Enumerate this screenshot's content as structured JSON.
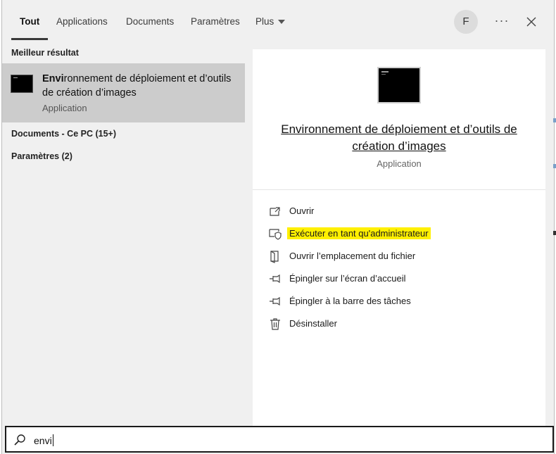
{
  "tabs": [
    {
      "label": "Tout",
      "active": true
    },
    {
      "label": "Applications"
    },
    {
      "label": "Documents"
    },
    {
      "label": "Paramètres"
    },
    {
      "label": "Plus"
    }
  ],
  "header": {
    "avatar_initial": "F",
    "more_label": "···",
    "close_icon": "close-icon"
  },
  "left": {
    "best_match_label": "Meilleur résultat",
    "best_match": {
      "title_bold": "Envi",
      "title_rest": "ronnement de déploiement et d’outils de création d’images",
      "type": "Application",
      "icon": "console-window-icon"
    },
    "groups": [
      {
        "label": "Documents - Ce PC (15+)"
      },
      {
        "label": "Paramètres (2)"
      }
    ]
  },
  "preview": {
    "title": "Environnement de déploiement et d’outils de création d’images",
    "type": "Application",
    "actions": [
      {
        "label": "Ouvrir",
        "icon": "open-icon"
      },
      {
        "label": "Exécuter en tant qu'administrateur",
        "icon": "run-as-admin-icon",
        "highlighted": true,
        "highlight_color": "#fff000"
      },
      {
        "label": "Ouvrir l’emplacement du fichier",
        "icon": "file-location-icon"
      },
      {
        "label": "Épingler sur l’écran d’accueil",
        "icon": "pin-icon"
      },
      {
        "label": "Épingler à la barre des tâches",
        "icon": "pin-icon"
      },
      {
        "label": "Désinstaller",
        "icon": "trash-icon"
      }
    ]
  },
  "search": {
    "value": "envi",
    "icon": "search-icon"
  },
  "colors": {
    "selected_bg": "#cccccc",
    "highlight": "#fff000",
    "panel_bg": "#ffffff",
    "window_bg": "#f0f0f0"
  }
}
